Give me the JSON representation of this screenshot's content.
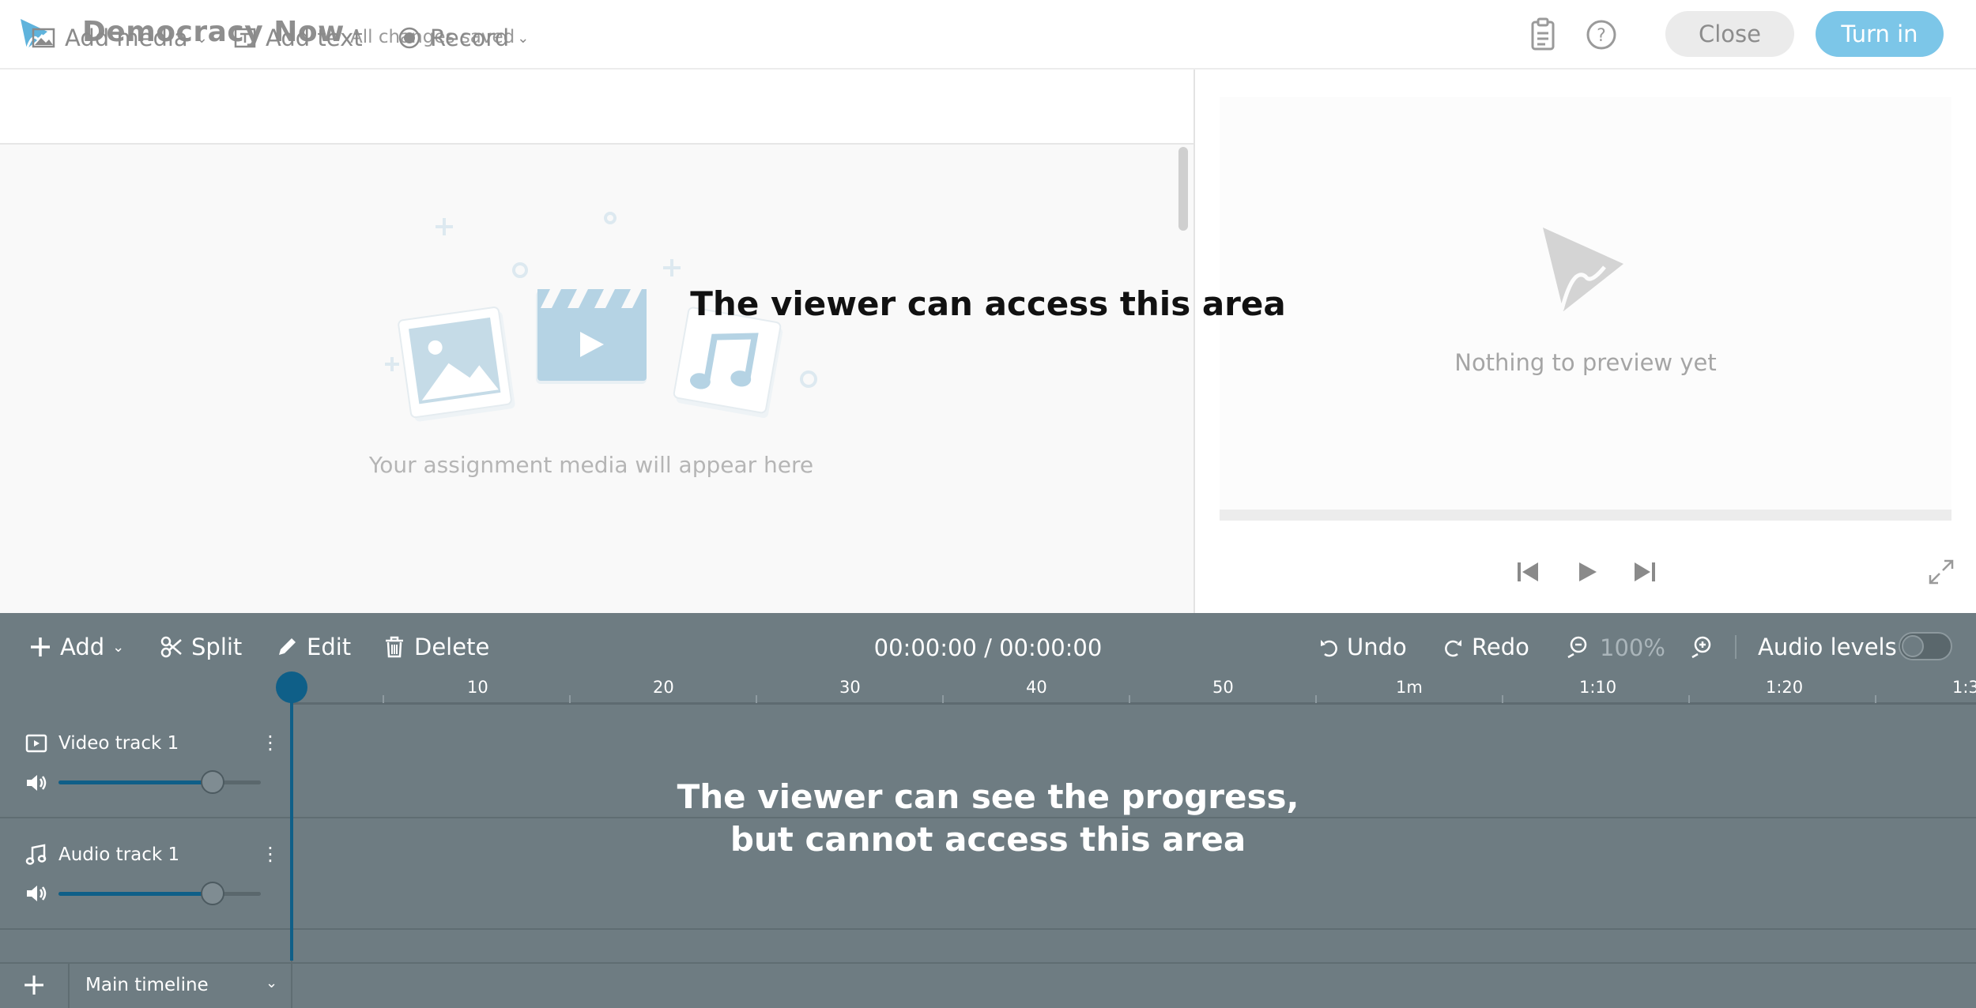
{
  "header": {
    "title": "Democracy Now",
    "save_status": "All changes saved",
    "close_label": "Close",
    "turn_in_label": "Turn in"
  },
  "media_toolbar": {
    "add_media_label": "Add media",
    "add_text_label": "Add text",
    "record_label": "Record"
  },
  "media_area": {
    "empty_text": "Your assignment media will appear here"
  },
  "preview": {
    "empty_text": "Nothing to preview yet"
  },
  "overlay": {
    "viewer_access_text": "The viewer can access this area",
    "progress_text_line1": "The viewer can see the progress,",
    "progress_text_line2": "but cannot access this area"
  },
  "timeline_toolbar": {
    "add_label": "Add",
    "split_label": "Split",
    "edit_label": "Edit",
    "delete_label": "Delete",
    "timecode": "00:00:00 / 00:00:00",
    "undo_label": "Undo",
    "redo_label": "Redo",
    "zoom_level": "100%",
    "audio_levels_label": "Audio levels"
  },
  "ruler": {
    "tick_labels": [
      "10",
      "20",
      "30",
      "40",
      "50",
      "1m",
      "1:10",
      "1:20",
      "1:3"
    ]
  },
  "tracks": [
    {
      "name": "Video track 1",
      "volume": 0.76
    },
    {
      "name": "Audio track 1",
      "volume": 0.76
    }
  ],
  "bottom_bar": {
    "add_symbol": "+",
    "timeline_name": "Main timeline"
  },
  "colors": {
    "accent": "#7cc6e8",
    "timeline_bg": "#6e7c82",
    "playhead": "#0f5f88"
  }
}
